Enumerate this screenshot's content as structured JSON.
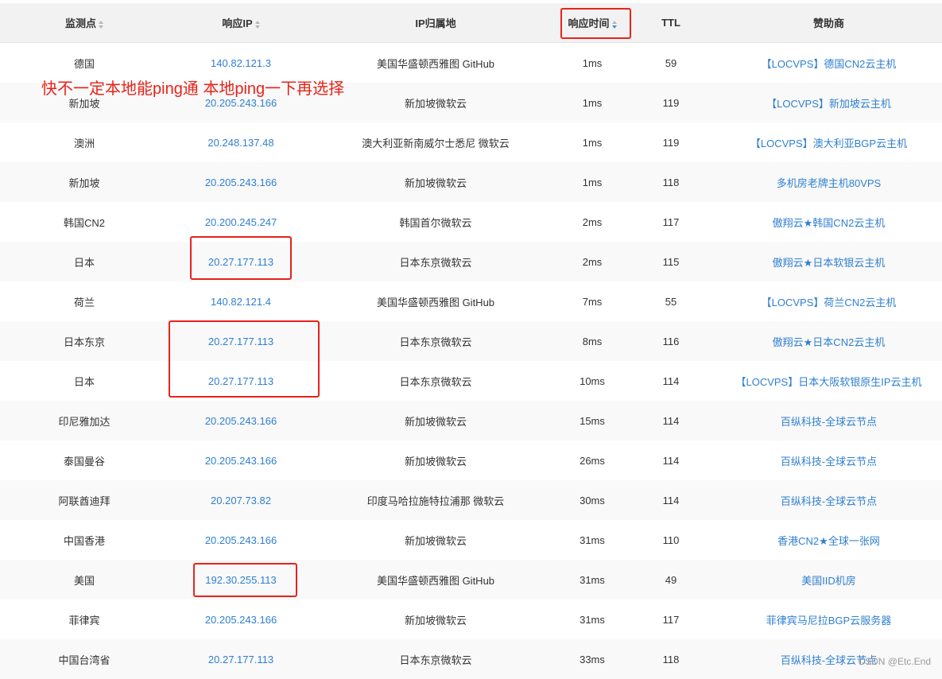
{
  "headers": {
    "monitor": "监测点",
    "ip": "响应IP",
    "location": "IP归属地",
    "time": "响应时间",
    "ttl": "TTL",
    "sponsor": "赞助商"
  },
  "rows": [
    {
      "monitor": "德国",
      "ip": "140.82.121.3",
      "location": "美国华盛顿西雅图 GitHub",
      "time": "1ms",
      "ttl": "59",
      "sponsor": "【LOCVPS】德国CN2云主机"
    },
    {
      "monitor": "新加坡",
      "ip": "20.205.243.166",
      "location": "新加坡微软云",
      "time": "1ms",
      "ttl": "119",
      "sponsor": "【LOCVPS】新加坡云主机"
    },
    {
      "monitor": "澳洲",
      "ip": "20.248.137.48",
      "location": "澳大利亚新南威尔士悉尼 微软云",
      "time": "1ms",
      "ttl": "119",
      "sponsor": "【LOCVPS】澳大利亚BGP云主机"
    },
    {
      "monitor": "新加坡",
      "ip": "20.205.243.166",
      "location": "新加坡微软云",
      "time": "1ms",
      "ttl": "118",
      "sponsor": "多机房老牌主机80VPS"
    },
    {
      "monitor": "韩国CN2",
      "ip": "20.200.245.247",
      "location": "韩国首尔微软云",
      "time": "2ms",
      "ttl": "117",
      "sponsor": "傲翔云★韩国CN2云主机"
    },
    {
      "monitor": "日本",
      "ip": "20.27.177.113",
      "location": "日本东京微软云",
      "time": "2ms",
      "ttl": "115",
      "sponsor": "傲翔云★日本软银云主机"
    },
    {
      "monitor": "荷兰",
      "ip": "140.82.121.4",
      "location": "美国华盛顿西雅图 GitHub",
      "time": "7ms",
      "ttl": "55",
      "sponsor": "【LOCVPS】荷兰CN2云主机"
    },
    {
      "monitor": "日本东京",
      "ip": "20.27.177.113",
      "location": "日本东京微软云",
      "time": "8ms",
      "ttl": "116",
      "sponsor": "傲翔云★日本CN2云主机"
    },
    {
      "monitor": "日本",
      "ip": "20.27.177.113",
      "location": "日本东京微软云",
      "time": "10ms",
      "ttl": "114",
      "sponsor": "【LOCVPS】日本大阪软银原生IP云主机"
    },
    {
      "monitor": "印尼雅加达",
      "ip": "20.205.243.166",
      "location": "新加坡微软云",
      "time": "15ms",
      "ttl": "114",
      "sponsor": "百纵科技-全球云节点"
    },
    {
      "monitor": "泰国曼谷",
      "ip": "20.205.243.166",
      "location": "新加坡微软云",
      "time": "26ms",
      "ttl": "114",
      "sponsor": "百纵科技-全球云节点"
    },
    {
      "monitor": "阿联酋迪拜",
      "ip": "20.207.73.82",
      "location": "印度马哈拉施特拉浦那 微软云",
      "time": "30ms",
      "ttl": "114",
      "sponsor": "百纵科技-全球云节点"
    },
    {
      "monitor": "中国香港",
      "ip": "20.205.243.166",
      "location": "新加坡微软云",
      "time": "31ms",
      "ttl": "110",
      "sponsor": "香港CN2★全球一张网"
    },
    {
      "monitor": "美国",
      "ip": "192.30.255.113",
      "location": "美国华盛顿西雅图 GitHub",
      "time": "31ms",
      "ttl": "49",
      "sponsor": "美国IID机房"
    },
    {
      "monitor": "菲律宾",
      "ip": "20.205.243.166",
      "location": "新加坡微软云",
      "time": "31ms",
      "ttl": "117",
      "sponsor": "菲律宾马尼拉BGP云服务器"
    },
    {
      "monitor": "中国台湾省",
      "ip": "20.27.177.113",
      "location": "日本东京微软云",
      "time": "33ms",
      "ttl": "118",
      "sponsor": "百纵科技-全球云节点"
    }
  ],
  "annotation": "快不一定本地能ping通  本地ping一下再选择",
  "watermark": "CSDN @Etc.End",
  "colors": {
    "link": "#2f7fd0",
    "highlight": "#e8231a",
    "header_bg": "#f2f2f2"
  }
}
